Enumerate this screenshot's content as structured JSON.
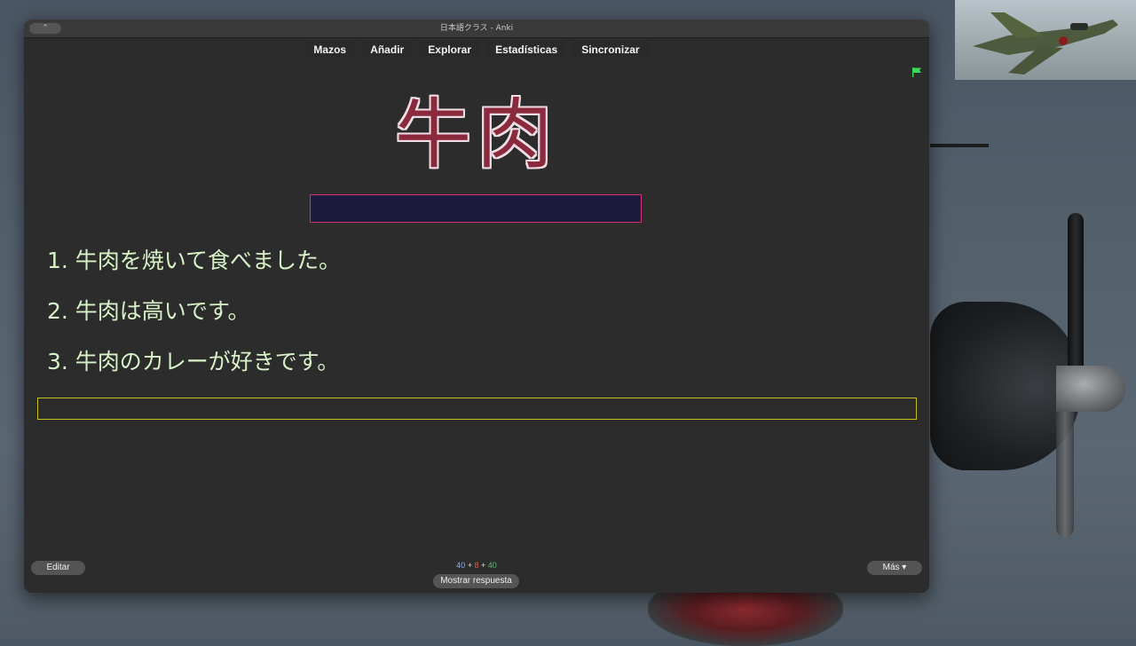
{
  "window": {
    "title": "日本語クラス - Anki",
    "close_glyph": "⌃"
  },
  "toolbar": {
    "items": [
      "Mazos",
      "Añadir",
      "Explorar",
      "Estadísticas",
      "Sincronizar"
    ]
  },
  "card": {
    "word": "牛肉",
    "flag_color": "#3ddc5a",
    "sentences": [
      "1. 牛肉を焼いて食べました。",
      "2. 牛肉は高いです。",
      "3. 牛肉のカレーが好きです。"
    ],
    "colors": {
      "word_fill": "#8b2a3d",
      "answer_box_border": "#d6326f",
      "typein_border": "#c9c21a",
      "sentence_text": "#d8f2c8"
    }
  },
  "bottombar": {
    "edit_label": "Editar",
    "counts": {
      "new": "40",
      "learning": "8",
      "review": "40",
      "sep": "+"
    },
    "show_answer_label": "Mostrar respuesta",
    "more_label": "Más ▾"
  }
}
